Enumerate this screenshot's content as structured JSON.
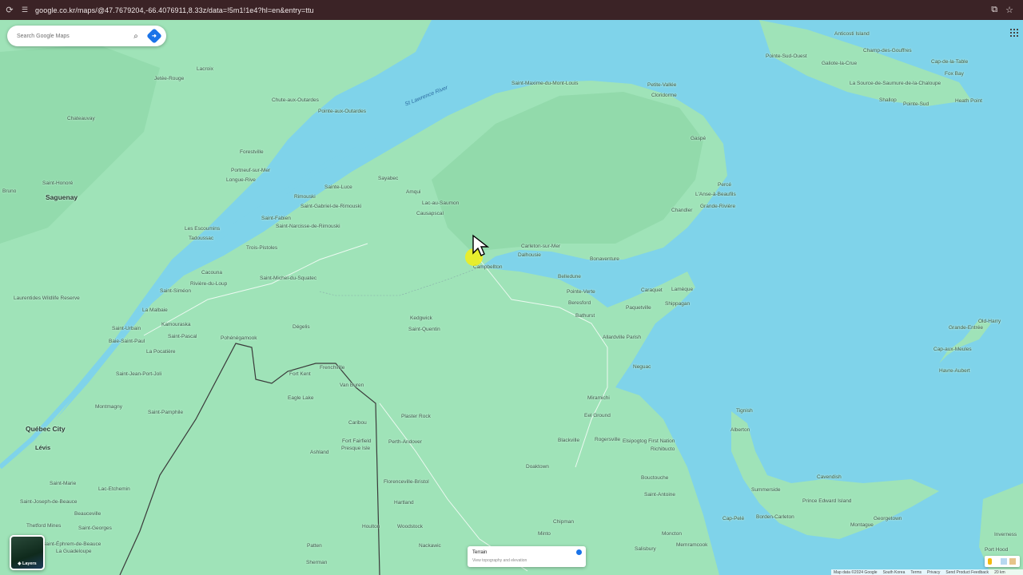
{
  "browser": {
    "url": "google.co.kr/maps/@47.7679204,-66.4076911,8.33z/data=!5m1!1e4?hl=en&entry=ttu",
    "reload_icon": "reload-icon",
    "site_info_icon": "site-info-icon",
    "install_icon": "install-app-icon",
    "bookmark_icon": "star-icon"
  },
  "search": {
    "placeholder": "Search Google Maps"
  },
  "layers": {
    "label": "Layers"
  },
  "terrain": {
    "title": "Terrain",
    "subtitle": "View topography and elevation",
    "enabled": true
  },
  "footer": {
    "map_data": "Map data ©2024 Google",
    "country": "South Korea",
    "terms": "Terms",
    "privacy": "Privacy",
    "feedback": "Send Product Feedback",
    "scale": "20 km"
  },
  "water_labels": [
    "St Lawrence River"
  ],
  "places": [
    {
      "name": "Anticosti Island",
      "kind": "town"
    },
    {
      "name": "Champ-des-Gouffres",
      "kind": "town"
    },
    {
      "name": "Pointe-Sud-Ouest",
      "kind": "town"
    },
    {
      "name": "Galiote-la-Crue",
      "kind": "town"
    },
    {
      "name": "Cap-de-la-Table",
      "kind": "town"
    },
    {
      "name": "Fox Bay",
      "kind": "town"
    },
    {
      "name": "La Source-de-Saumure-de-la-Chaloupe",
      "kind": "town"
    },
    {
      "name": "Shallop",
      "kind": "town"
    },
    {
      "name": "Pointe-Sud",
      "kind": "town"
    },
    {
      "name": "Heath Point",
      "kind": "town"
    },
    {
      "name": "Saint-Maxime-du-Mont-Louis",
      "kind": "town"
    },
    {
      "name": "Petite-Vallée",
      "kind": "town"
    },
    {
      "name": "Cloridorme",
      "kind": "town"
    },
    {
      "name": "Gaspé",
      "kind": "town"
    },
    {
      "name": "Percé",
      "kind": "town"
    },
    {
      "name": "L'Anse-à-Beaufils",
      "kind": "town"
    },
    {
      "name": "Grande-Rivière",
      "kind": "town"
    },
    {
      "name": "Chandler",
      "kind": "town"
    },
    {
      "name": "Sayabec",
      "kind": "town"
    },
    {
      "name": "Amqui",
      "kind": "town"
    },
    {
      "name": "Lac-au-Saumon",
      "kind": "town"
    },
    {
      "name": "Causapscal",
      "kind": "town"
    },
    {
      "name": "Carleton-sur-Mer",
      "kind": "town"
    },
    {
      "name": "Dalhousie",
      "kind": "town"
    },
    {
      "name": "Campbellton",
      "kind": "town"
    },
    {
      "name": "Bonaventure",
      "kind": "town"
    },
    {
      "name": "Sainte-Luce",
      "kind": "town"
    },
    {
      "name": "Rimouski",
      "kind": "town"
    },
    {
      "name": "Saint-Gabriel-de-Rimouski",
      "kind": "town"
    },
    {
      "name": "Saint-Fabien",
      "kind": "town"
    },
    {
      "name": "Saint-Narcisse-de-Rimouski",
      "kind": "town"
    },
    {
      "name": "Trois-Pistoles",
      "kind": "town"
    },
    {
      "name": "Cacouna",
      "kind": "town"
    },
    {
      "name": "Rivière-du-Loup",
      "kind": "town"
    },
    {
      "name": "Saint-Michel-du-Squatec",
      "kind": "town"
    },
    {
      "name": "Saint-Siméon",
      "kind": "town"
    },
    {
      "name": "La Malbaie",
      "kind": "town"
    },
    {
      "name": "Kamouraska",
      "kind": "town"
    },
    {
      "name": "Saint-Urbain",
      "kind": "town"
    },
    {
      "name": "Baie-Saint-Paul",
      "kind": "town"
    },
    {
      "name": "La Pocatière",
      "kind": "town"
    },
    {
      "name": "Saint-Pascal",
      "kind": "town"
    },
    {
      "name": "Saint-Jean-Port-Joli",
      "kind": "town"
    },
    {
      "name": "Pohénégamook",
      "kind": "town"
    },
    {
      "name": "Dégelis",
      "kind": "town"
    },
    {
      "name": "Saguenay",
      "kind": "city"
    },
    {
      "name": "Saint-Honoré",
      "kind": "town"
    },
    {
      "name": "Bruno",
      "kind": "town"
    },
    {
      "name": "Tadoussac",
      "kind": "town"
    },
    {
      "name": "Les Escoumins",
      "kind": "town"
    },
    {
      "name": "Forestville",
      "kind": "town"
    },
    {
      "name": "Portneuf-sur-Mer",
      "kind": "town"
    },
    {
      "name": "Longue-Rive",
      "kind": "town"
    },
    {
      "name": "Chute-aux-Outardes",
      "kind": "town"
    },
    {
      "name": "Pointe-aux-Outardes",
      "kind": "town"
    },
    {
      "name": "Jetée-Rouge",
      "kind": "town"
    },
    {
      "name": "Lacroix",
      "kind": "town"
    },
    {
      "name": "Chateauvay",
      "kind": "town"
    },
    {
      "name": "Québec City",
      "kind": "city"
    },
    {
      "name": "Lévis",
      "kind": "city"
    },
    {
      "name": "Montmagny",
      "kind": "town"
    },
    {
      "name": "Saint-Pamphile",
      "kind": "town"
    },
    {
      "name": "Saint-Marie",
      "kind": "town"
    },
    {
      "name": "La Guadeloupe",
      "kind": "town"
    },
    {
      "name": "Saint-Georges",
      "kind": "town"
    },
    {
      "name": "Thetford Mines",
      "kind": "town"
    },
    {
      "name": "Beauceville",
      "kind": "town"
    },
    {
      "name": "Saint-Éphrem-de-Beauce",
      "kind": "town"
    },
    {
      "name": "Lac-Etchemin",
      "kind": "town"
    },
    {
      "name": "Fort Kent",
      "kind": "town"
    },
    {
      "name": "Frenchville",
      "kind": "town"
    },
    {
      "name": "Van Buren",
      "kind": "town"
    },
    {
      "name": "Eagle Lake",
      "kind": "town"
    },
    {
      "name": "Caribou",
      "kind": "town"
    },
    {
      "name": "Fort Fairfield",
      "kind": "town"
    },
    {
      "name": "Presque Isle",
      "kind": "town"
    },
    {
      "name": "Ashland",
      "kind": "town"
    },
    {
      "name": "Plaster Rock",
      "kind": "town"
    },
    {
      "name": "Perth-Andover",
      "kind": "town"
    },
    {
      "name": "Florenceville-Bristol",
      "kind": "town"
    },
    {
      "name": "Hartland",
      "kind": "town"
    },
    {
      "name": "Woodstock",
      "kind": "town"
    },
    {
      "name": "Houlton",
      "kind": "town"
    },
    {
      "name": "Patten",
      "kind": "town"
    },
    {
      "name": "Sherman",
      "kind": "town"
    },
    {
      "name": "Nackawic",
      "kind": "town"
    },
    {
      "name": "Kedgwick",
      "kind": "town"
    },
    {
      "name": "Saint-Quentin",
      "kind": "town"
    },
    {
      "name": "Belledune",
      "kind": "town"
    },
    {
      "name": "Pointe-Verte",
      "kind": "town"
    },
    {
      "name": "Beresford",
      "kind": "town"
    },
    {
      "name": "Bathurst",
      "kind": "town"
    },
    {
      "name": "Caraquet",
      "kind": "town"
    },
    {
      "name": "Lamèque",
      "kind": "town"
    },
    {
      "name": "Shippagan",
      "kind": "town"
    },
    {
      "name": "Paquetville",
      "kind": "town"
    },
    {
      "name": "Allardville Parish",
      "kind": "town"
    },
    {
      "name": "Neguac",
      "kind": "town"
    },
    {
      "name": "Miramichi",
      "kind": "town"
    },
    {
      "name": "Eel Ground",
      "kind": "town"
    },
    {
      "name": "Blackville",
      "kind": "town"
    },
    {
      "name": "Rogersville",
      "kind": "town"
    },
    {
      "name": "Doaktown",
      "kind": "town"
    },
    {
      "name": "Elsipogtog First Nation",
      "kind": "town"
    },
    {
      "name": "Richibucto",
      "kind": "town"
    },
    {
      "name": "Bouctouche",
      "kind": "town"
    },
    {
      "name": "Saint-Antoine",
      "kind": "town"
    },
    {
      "name": "Chipman",
      "kind": "town"
    },
    {
      "name": "Minto",
      "kind": "town"
    },
    {
      "name": "Moncton",
      "kind": "town"
    },
    {
      "name": "Memramcook",
      "kind": "town"
    },
    {
      "name": "Salisbury",
      "kind": "town"
    },
    {
      "name": "Cap-Pelé",
      "kind": "town"
    },
    {
      "name": "Tignish",
      "kind": "town"
    },
    {
      "name": "Alberton",
      "kind": "town"
    },
    {
      "name": "Summerside",
      "kind": "town"
    },
    {
      "name": "Cavendish",
      "kind": "town"
    },
    {
      "name": "Prince Edward Island",
      "kind": "town"
    },
    {
      "name": "Borden-Carleton",
      "kind": "town"
    },
    {
      "name": "Georgetown",
      "kind": "town"
    },
    {
      "name": "Montague",
      "kind": "town"
    },
    {
      "name": "Old-Harry",
      "kind": "town"
    },
    {
      "name": "Grande-Entrée",
      "kind": "town"
    },
    {
      "name": "Cap-aux-Meules",
      "kind": "town"
    },
    {
      "name": "Havre-Aubert",
      "kind": "town"
    },
    {
      "name": "Inverness",
      "kind": "town"
    },
    {
      "name": "Port Hood",
      "kind": "town"
    },
    {
      "name": "Laurentides Wildlife Reserve",
      "kind": "town"
    },
    {
      "name": "Saint-Joseph-de-Beauce",
      "kind": "town"
    }
  ]
}
